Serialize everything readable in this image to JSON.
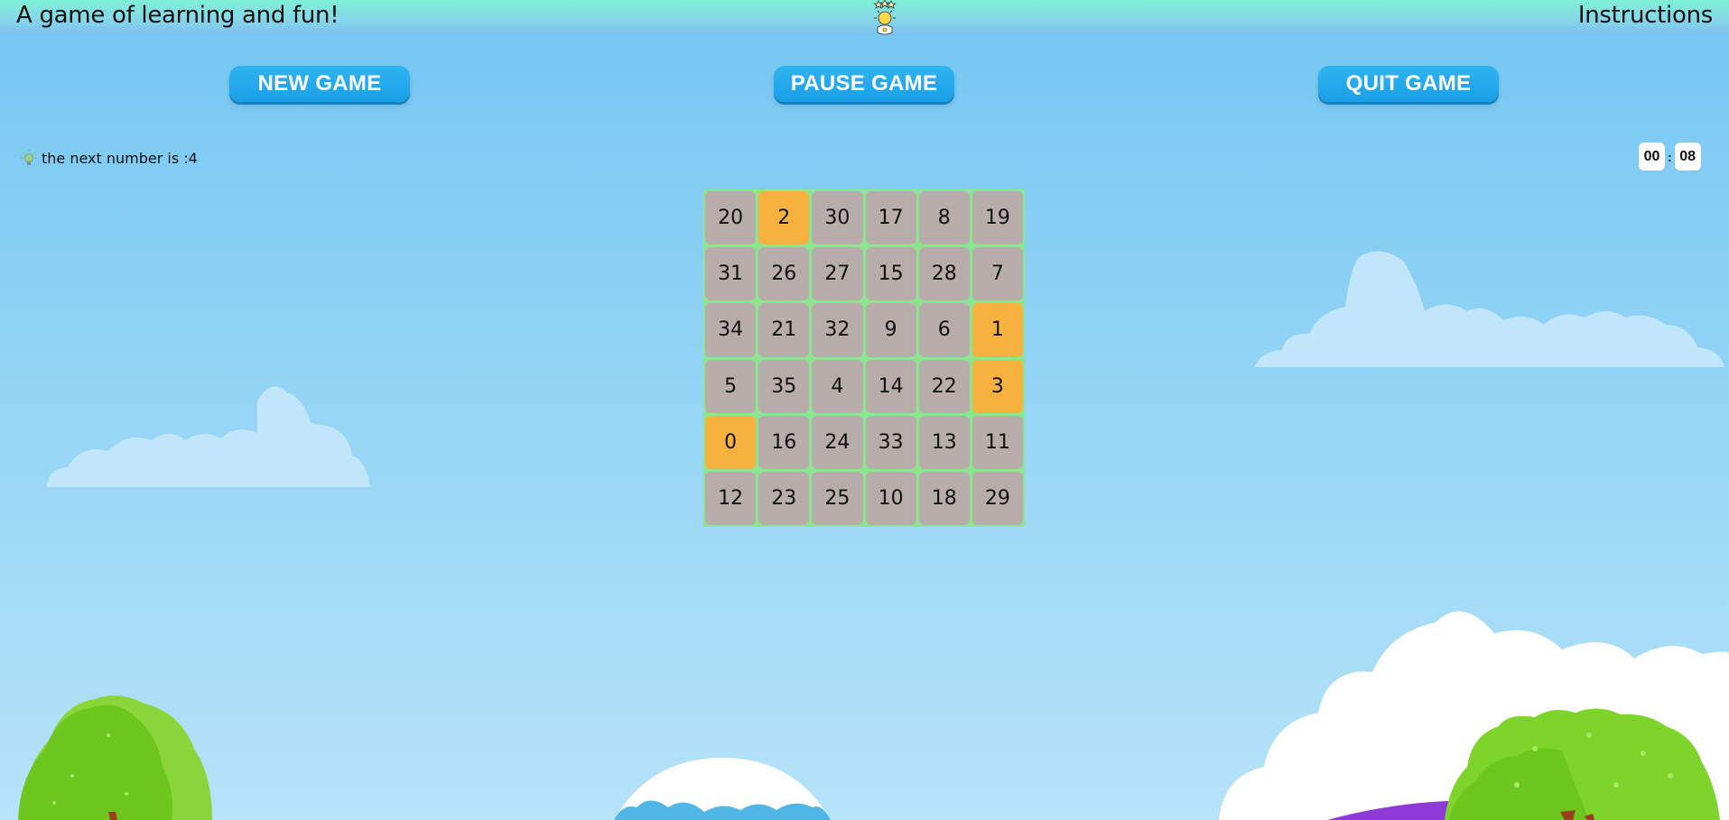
{
  "header": {
    "tagline": "A game of learning and fun!",
    "instructions_label": "Instructions",
    "mascot_icon": "star-crowned-sun-mascot-icon"
  },
  "controls": {
    "new_game": "NEW GAME",
    "pause_game": "PAUSE GAME",
    "quit_game": "QUIT GAME"
  },
  "hint": {
    "icon": "lightbulb-icon",
    "text": "the next number is :4"
  },
  "timer": {
    "minutes": "00",
    "separator": ":",
    "seconds": "08"
  },
  "board": {
    "tiles": [
      [
        {
          "n": "20",
          "found": false
        },
        {
          "n": "2",
          "found": true
        },
        {
          "n": "30",
          "found": false
        },
        {
          "n": "17",
          "found": false
        },
        {
          "n": "8",
          "found": false
        },
        {
          "n": "19",
          "found": false
        }
      ],
      [
        {
          "n": "31",
          "found": false
        },
        {
          "n": "26",
          "found": false
        },
        {
          "n": "27",
          "found": false
        },
        {
          "n": "15",
          "found": false
        },
        {
          "n": "28",
          "found": false
        },
        {
          "n": "7",
          "found": false
        }
      ],
      [
        {
          "n": "34",
          "found": false
        },
        {
          "n": "21",
          "found": false
        },
        {
          "n": "32",
          "found": false
        },
        {
          "n": "9",
          "found": false
        },
        {
          "n": "6",
          "found": false
        },
        {
          "n": "1",
          "found": true
        }
      ],
      [
        {
          "n": "5",
          "found": false
        },
        {
          "n": "35",
          "found": false
        },
        {
          "n": "4",
          "found": false
        },
        {
          "n": "14",
          "found": false
        },
        {
          "n": "22",
          "found": false
        },
        {
          "n": "3",
          "found": true
        }
      ],
      [
        {
          "n": "0",
          "found": true
        },
        {
          "n": "16",
          "found": false
        },
        {
          "n": "24",
          "found": false
        },
        {
          "n": "33",
          "found": false
        },
        {
          "n": "13",
          "found": false
        },
        {
          "n": "11",
          "found": false
        }
      ],
      [
        {
          "n": "12",
          "found": false
        },
        {
          "n": "23",
          "found": false
        },
        {
          "n": "25",
          "found": false
        },
        {
          "n": "10",
          "found": false
        },
        {
          "n": "18",
          "found": false
        },
        {
          "n": "29",
          "found": false
        }
      ]
    ]
  },
  "colors": {
    "tile": "#b8adab",
    "tile_found": "#f7b13f",
    "board_border": "#8ae68f",
    "button": "#1ea6ea",
    "cloud": "#c2e6f9",
    "tree": "#6cc61e",
    "hill": "#8f3ad6"
  },
  "scenery": [
    "cloud-icon",
    "tree-icon",
    "snowy-mountain-icon",
    "hill-icon"
  ]
}
